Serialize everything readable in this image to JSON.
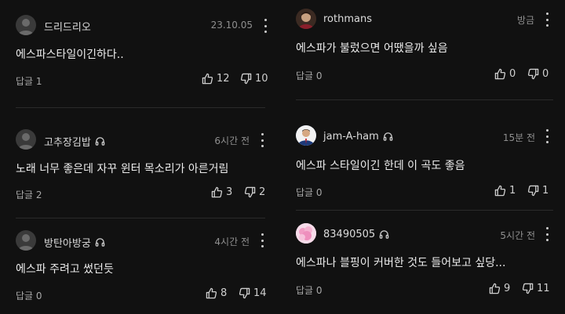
{
  "left_column": [
    {
      "author": "드리드리오",
      "time": "23.10.05",
      "text": "에스파스타일이긴하다..",
      "reply": "답글 1",
      "likes": "12",
      "dislikes": "10",
      "headset": false,
      "avatar": "default-avatar"
    },
    {
      "author": "고추장김밥",
      "time": "6시간 전",
      "text": "노래 너무 좋은데 자꾸 윈터 목소리가 아른거림",
      "reply": "답글 2",
      "likes": "3",
      "dislikes": "2",
      "headset": true,
      "avatar": "default-avatar"
    },
    {
      "author": "방탄아방궁",
      "time": "4시간 전",
      "text": "에스파 주려고 썼던듯",
      "reply": "답글 0",
      "likes": "8",
      "dislikes": "14",
      "headset": true,
      "avatar": "default-avatar"
    }
  ],
  "right_column": [
    {
      "author": "rothmans",
      "time": "방금",
      "text": "에스파가 불렀으면 어땠을까 싶음",
      "reply": "답글 0",
      "likes": "0",
      "dislikes": "0",
      "headset": false,
      "avatar": "photo-avatar"
    },
    {
      "author": "jam-A-ham",
      "time": "15분 전",
      "text": "에스파 스타일이긴 한데 이 곡도 좋음",
      "reply": "답글 0",
      "likes": "1",
      "dislikes": "1",
      "headset": true,
      "avatar": "suit-avatar"
    },
    {
      "author": "83490505",
      "time": "5시간 전",
      "text": "에스파나 블핑이 커버한 것도 들어보고 싶당...",
      "reply": "답글 0",
      "likes": "9",
      "dislikes": "11",
      "headset": true,
      "avatar": "flower-avatar"
    }
  ],
  "colors": {
    "background": "#111111",
    "divider": "#2b2b2b",
    "text": "#ececec",
    "muted": "#8f8f8f"
  }
}
